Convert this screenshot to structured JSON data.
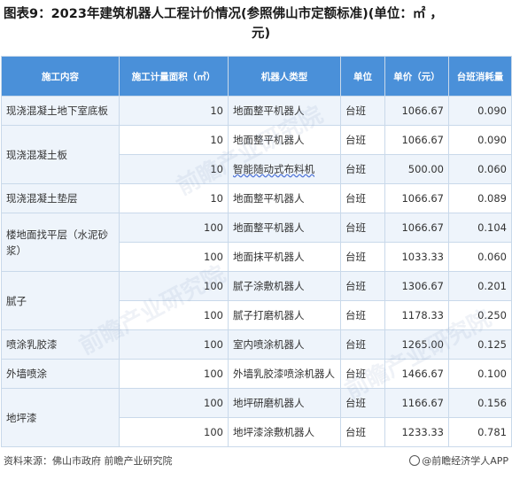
{
  "title_line1": "图表9：2023年建筑机器人工程计价情况(参照佛山市定额标准)(单位：㎡ ，",
  "title_line2": "元)",
  "table": {
    "headers": [
      "施工内容",
      "施工计量面积（㎡）",
      "机器人类型",
      "单位",
      "单价（元）",
      "台班消耗量"
    ],
    "rows": [
      {
        "area": "10",
        "robot": "地面整平机器人",
        "unit": "台班",
        "price": "1066.67",
        "consumption": "0.090"
      },
      {
        "area": "10",
        "robot": "地面整平机器人",
        "unit": "台班",
        "price": "1066.67",
        "consumption": "0.090"
      },
      {
        "area": "10",
        "robot": "智能随动式布料机",
        "unit": "台班",
        "price": "500.00",
        "consumption": "0.060"
      },
      {
        "area": "10",
        "robot": "地面整平机器人",
        "unit": "台班",
        "price": "1066.67",
        "consumption": "0.089"
      },
      {
        "area": "100",
        "robot": "地面整平机器人",
        "unit": "台班",
        "price": "1066.67",
        "consumption": "0.104"
      },
      {
        "area": "100",
        "robot": "地面抹平机器人",
        "unit": "台班",
        "price": "1033.33",
        "consumption": "0.060"
      },
      {
        "area": "100",
        "robot": "腻子涂敷机器人",
        "unit": "台班",
        "price": "1306.67",
        "consumption": "0.201"
      },
      {
        "area": "100",
        "robot": "腻子打磨机器人",
        "unit": "台班",
        "price": "1178.33",
        "consumption": "0.250"
      },
      {
        "area": "100",
        "robot": "室内喷涂机器人",
        "unit": "台班",
        "price": "1265.00",
        "consumption": "0.125"
      },
      {
        "area": "100",
        "robot": "外墙乳胶漆喷涂机器人",
        "unit": "台班",
        "price": "1466.67",
        "consumption": "0.100"
      },
      {
        "area": "100",
        "robot": "地坪研磨机器人",
        "unit": "台班",
        "price": "1166.67",
        "consumption": "0.156"
      },
      {
        "area": "100",
        "robot": "地坪漆涂敷机器人",
        "unit": "台班",
        "price": "1233.33",
        "consumption": "0.781"
      }
    ],
    "groups": [
      "现浇混凝土地下室底板",
      "现浇混凝土板",
      "现浇混凝土垫层",
      "楼地面找平层（水泥砂浆）",
      "腻子",
      "喷涂乳胶漆",
      "外墙喷涂",
      "地坪漆"
    ]
  },
  "footer": {
    "source": "资料来源：佛山市政府 前瞻产业研究院",
    "brand": "@前瞻经济学人APP"
  },
  "watermark_text": "前瞻产业研究院"
}
